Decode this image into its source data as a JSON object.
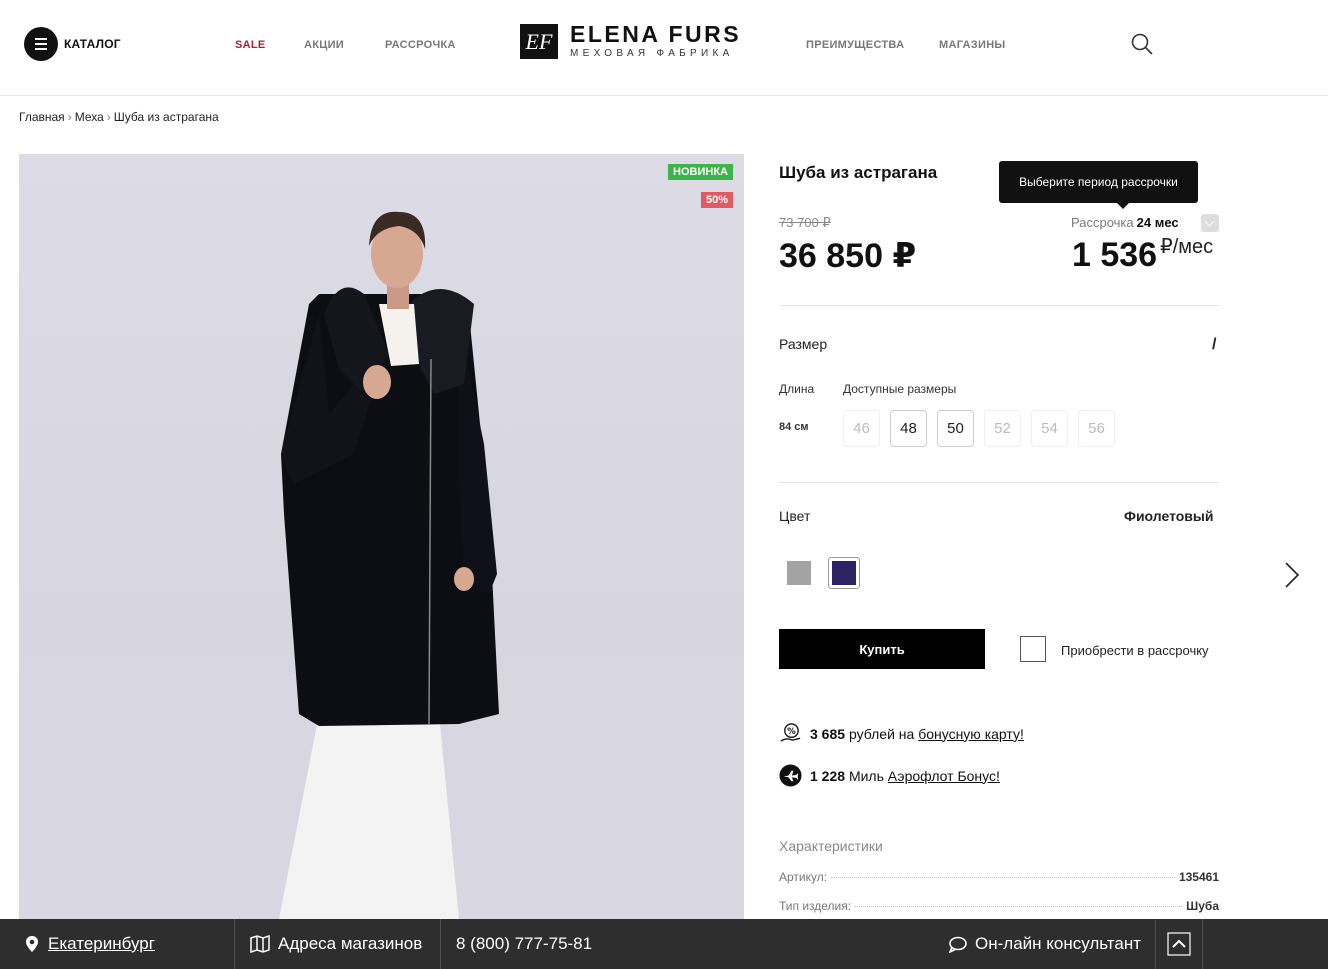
{
  "header": {
    "catalog_label": "КАТАЛОГ",
    "nav": [
      "SALE",
      "АКЦИИ",
      "РАССРОЧКА",
      "ПРЕИМУЩЕСТВА",
      "МАГАЗИНЫ"
    ],
    "logo_mark": "EF",
    "logo_title": "ELENA FURS",
    "logo_subtitle": "МЕХОВАЯ ФАБРИКА"
  },
  "breadcrumbs": [
    "Главная",
    "Меха",
    "Шуба из астрагана"
  ],
  "breadcrumb_sep": "›",
  "gallery": {
    "badge_new": "НОВИНКА",
    "badge_discount": "50%"
  },
  "product": {
    "title": "Шуба из астрагана",
    "old_price": "73 700 ₽",
    "price": "36 850 ₽",
    "installment_tooltip": "Выберите период рассрочки",
    "installment_label": "Рассрочка",
    "installment_period": "24 мес",
    "installment_price": "1 536",
    "installment_unit": "₽/мес",
    "size_label": "Размер",
    "size_value": "/",
    "length_label": "Длина",
    "length_value": "84 см",
    "available_sizes_label": "Доступные размеры",
    "sizes": [
      {
        "value": "46",
        "available": false
      },
      {
        "value": "48",
        "available": true
      },
      {
        "value": "50",
        "available": true
      },
      {
        "value": "52",
        "available": false
      },
      {
        "value": "54",
        "available": false
      },
      {
        "value": "56",
        "available": false
      }
    ],
    "color_label": "Цвет",
    "color_value": "Фиолетовый",
    "colors": [
      "#a3a3a3",
      "#2e2362"
    ],
    "selected_color_index": 1,
    "buy_label": "Купить",
    "installment_checkbox_label": "Приобрести в рассрочку",
    "bonus_amount": "3 685",
    "bonus_text": "рублей на",
    "bonus_link": "бонусную карту!",
    "miles_amount": "1 228",
    "miles_text": "Миль",
    "miles_link": "Аэрофлот Бонус!",
    "characteristics_title": "Характеристики",
    "characteristics": [
      {
        "key": "Артикул:",
        "value": "135461"
      },
      {
        "key": "Тип изделия:",
        "value": "Шуба"
      }
    ]
  },
  "footer": {
    "city": "Екатеринбург",
    "stores": "Адреса магазинов",
    "phone": "8 (800) 777-75-81",
    "consultant": "Он-лайн консультант"
  },
  "colors": {
    "accent_sale": "#a8203a",
    "badge_new": "#3ab54a",
    "badge_discount": "#e05a62",
    "footer_bg": "#2e2e2e"
  }
}
